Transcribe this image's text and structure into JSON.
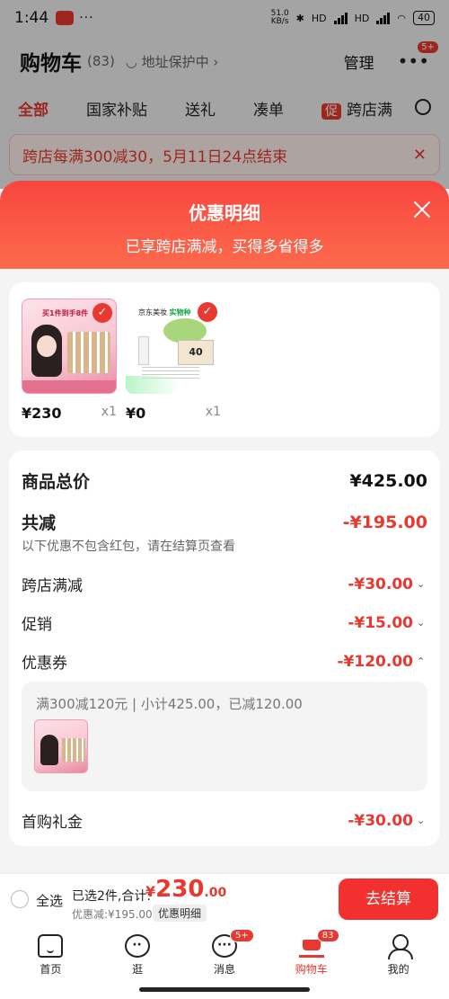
{
  "status": {
    "time": "1:44",
    "dots": "···",
    "net_speed": "51.0",
    "net_unit": "KB/s",
    "hd1": "HD",
    "hd2": "HD",
    "battery": "40"
  },
  "cart": {
    "title": "购物车",
    "count": "(83)",
    "address": "◡ 地址保护中 ›",
    "manage": "管理",
    "more_badge": "5+",
    "tabs": [
      "全部",
      "国家补贴",
      "送礼",
      "凑单",
      "跨店满"
    ],
    "promo_tag": "促",
    "banner": "跨店每满300减30，5月11日24点结束"
  },
  "sheet": {
    "title": "优惠明细",
    "subtitle": "已享跨店满减，买得多省得多",
    "products": [
      {
        "price": "¥230",
        "qty": "x1",
        "image_header": "买1件到手8件",
        "image_alt": "beauty set with model"
      },
      {
        "price": "¥0",
        "qty": "x1",
        "image_brand": "京东美妆",
        "image_brand_tag": "实物种",
        "image_box_text": "40",
        "image_alt": "sample gift pack"
      }
    ],
    "total_label": "商品总价",
    "total_value": "¥425.00",
    "reduce_label": "共减",
    "reduce_value": "-¥195.00",
    "reduce_note": "以下优惠不包含红包，请在结算页查看",
    "items": [
      {
        "label": "跨店满减",
        "value": "-¥30.00",
        "chevron": "⌄"
      },
      {
        "label": "促销",
        "value": "-¥15.00",
        "chevron": "⌄"
      },
      {
        "label": "优惠券",
        "value": "-¥120.00",
        "chevron": "⌃"
      }
    ],
    "coupon_detail": "满300减120元 | 小计425.00，已减120.00",
    "first_gift_label": "首购礼金",
    "first_gift_value": "-¥30.00",
    "first_gift_chevron": "⌄"
  },
  "checkout": {
    "select_all": "全选",
    "selected_text": "已选2件,合计:",
    "currency": "¥",
    "total_int": "230",
    "total_dec": ".00",
    "saved_text": "优惠减:¥195.00",
    "detail_btn": "优惠明细",
    "go_button": "去结算"
  },
  "tabbar": [
    {
      "label": "首页",
      "icon": "home-icon"
    },
    {
      "label": "逛",
      "icon": "browse-icon"
    },
    {
      "label": "消息",
      "icon": "message-icon",
      "badge": "5+"
    },
    {
      "label": "购物车",
      "icon": "cart-icon",
      "badge": "83",
      "active": true
    },
    {
      "label": "我的",
      "icon": "profile-icon"
    }
  ],
  "colors": {
    "accent": "#e8382f",
    "header_gradient_start": "#f7463f",
    "header_gradient_end": "#fd6a4c"
  }
}
